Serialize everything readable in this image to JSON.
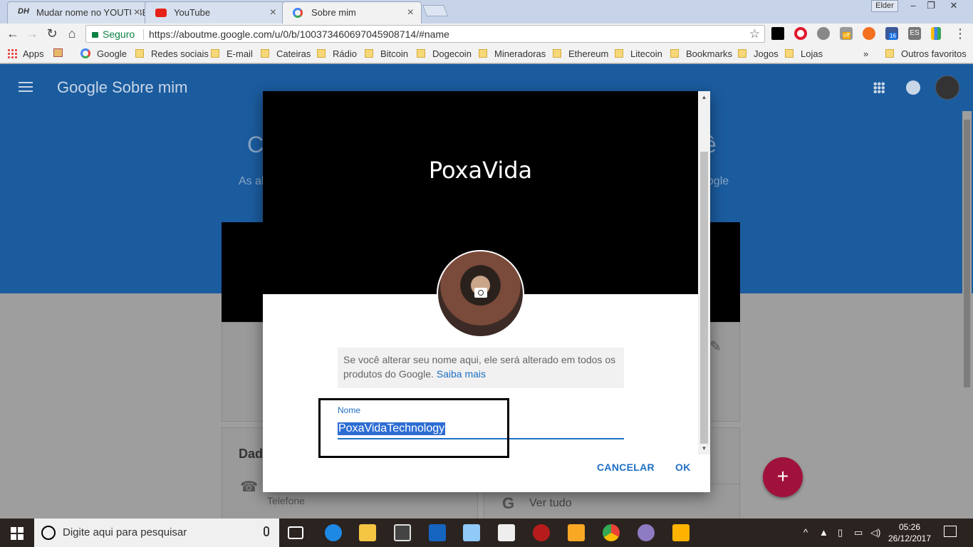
{
  "browser": {
    "tabs": [
      {
        "title": "Mudar nome no YOUTUBE",
        "active": false
      },
      {
        "title": "YouTube",
        "active": false
      },
      {
        "title": "Sobre mim",
        "active": true
      }
    ],
    "profile_label": "Elder",
    "secure_label": "Seguro",
    "url": "https://aboutme.google.com/u/0/b/100373460697045908714/#name",
    "extension_badge_off": "off",
    "extension_badge_16": "16",
    "extension_lang": "ES"
  },
  "bookmarks": {
    "items": [
      "Apps",
      "Google",
      "Redes sociais",
      "E-mail",
      "Cateiras",
      "Rádio",
      "Bitcoin",
      "Dogecoin",
      "Mineradoras",
      "Ethereum",
      "Litecoin",
      "Bookmarks",
      "Jogos",
      "Lojas"
    ],
    "overflow": "»",
    "other": "Outros favoritos"
  },
  "page": {
    "brand_google": "Google",
    "brand_product": "Sobre mim",
    "header_big_left": "C",
    "header_big_right": "ê",
    "header_small_left": "As al",
    "header_small_right": "oogle",
    "card_title": "Dad",
    "phone_label": "Telefone",
    "see_all": "Ver tudo",
    "fab_label": "+"
  },
  "dialog": {
    "cover_title": "PoxaVida",
    "info_text": "Se você alterar seu nome aqui, ele será alterado em todos os produtos do Google. ",
    "info_link": "Saiba mais",
    "name_label": "Nome",
    "name_value": "PoxaVidaTechnology",
    "cancel_label": "CANCELAR",
    "ok_label": "OK"
  },
  "taskbar": {
    "search_placeholder": "Digite aqui para pesquisar",
    "time": "05:26",
    "date": "26/12/2017"
  },
  "colors": {
    "header_blue": "#1b5c9f",
    "accent_blue": "#1f6fc4",
    "fab_red": "#a0123c",
    "selection": "#2d6cd3"
  }
}
